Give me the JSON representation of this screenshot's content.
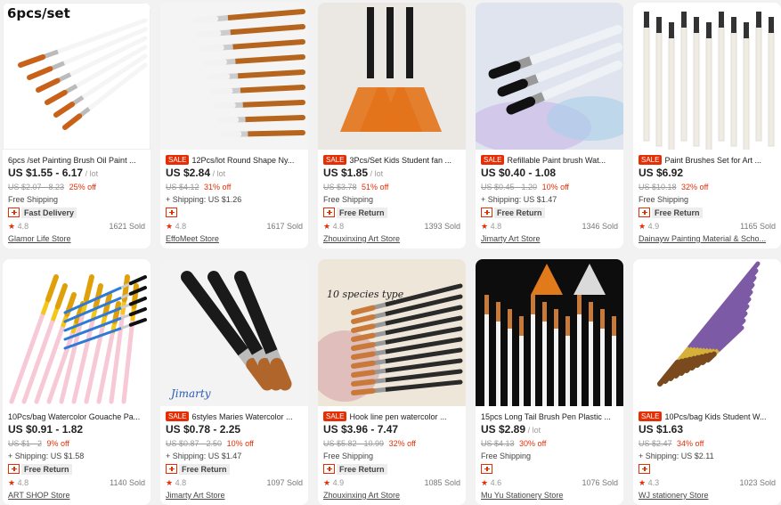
{
  "products": [
    {
      "img_label": "6pcs/set",
      "sale": false,
      "title": "6pcs /set Painting Brush Oil Paint ...",
      "price": "US $1.55 - 6.17",
      "unit": "/ lot",
      "orig": "US $2.07 - 8.23",
      "discount": "25% off",
      "shipping": "Free Shipping",
      "badge": "Fast Delivery",
      "rating": "4.8",
      "sold": "1621 Sold",
      "store": "Glamor Life Store"
    },
    {
      "img_label": "",
      "sale": true,
      "title": "12Pcs/lot Round Shape Ny...",
      "price": "US $2.84",
      "unit": "/ lot",
      "orig": "US $4.12",
      "discount": "31% off",
      "shipping": "+ Shipping: US $1.26",
      "badge": "",
      "rating": "4.8",
      "sold": "1617 Sold",
      "store": "EffoMeet Store"
    },
    {
      "img_label": "",
      "sale": true,
      "title": "3Pcs/Set Kids Student fan ...",
      "price": "US $1.85",
      "unit": "/ lot",
      "orig": "US $3.78",
      "discount": "51% off",
      "shipping": "Free Shipping",
      "badge": "Free Return",
      "rating": "4.8",
      "sold": "1393 Sold",
      "store": "Zhouxinxing Art Store"
    },
    {
      "img_label": "",
      "sale": true,
      "title": "Refillable Paint brush Wat...",
      "price": "US $0.40 - 1.08",
      "unit": "",
      "orig": "US $0.45 - 1.20",
      "discount": "10% off",
      "shipping": "+ Shipping: US $1.47",
      "badge": "Free Return",
      "rating": "4.8",
      "sold": "1346 Sold",
      "store": "Jimarty Art Store"
    },
    {
      "img_label": "",
      "sale": true,
      "title": "Paint Brushes Set for Art ...",
      "price": "US $6.92",
      "unit": "",
      "orig": "US $10.18",
      "discount": "32% off",
      "shipping": "Free Shipping",
      "badge": "Free Return",
      "rating": "4.9",
      "sold": "1165 Sold",
      "store": "Dainayw Painting Material & Scho..."
    },
    {
      "img_label": "",
      "sale": false,
      "title": "10Pcs/bag Watercolor Gouache Pa...",
      "price": "US $0.91 - 1.82",
      "unit": "",
      "orig": "US $1 - 2",
      "discount": "9% off",
      "shipping": "+ Shipping: US $1.58",
      "badge": "Free Return",
      "rating": "4.8",
      "sold": "1140 Sold",
      "store": "ART SHOP Store"
    },
    {
      "img_label": "",
      "sale": true,
      "title": "6styles Maries Watercolor ...",
      "price": "US $0.78 - 2.25",
      "unit": "",
      "orig": "US $0.87 - 2.50",
      "discount": "10% off",
      "shipping": "+ Shipping: US $1.47",
      "badge": "Free Return",
      "rating": "4.8",
      "sold": "1097 Sold",
      "store": "Jimarty Art Store"
    },
    {
      "img_label": "",
      "sale": true,
      "title": "Hook line pen watercolor ...",
      "price": "US $3.96 - 7.47",
      "unit": "",
      "orig": "US $5.82 - 10.99",
      "discount": "32% off",
      "shipping": "Free Shipping",
      "badge": "Free Return",
      "rating": "4.9",
      "sold": "1085 Sold",
      "store": "Zhouxinxing Art Store"
    },
    {
      "img_label": "",
      "sale": false,
      "title": "15pcs Long Tail Brush Pen Plastic ...",
      "price": "US $2.89",
      "unit": "/ lot",
      "orig": "US $4.13",
      "discount": "30% off",
      "shipping": "Free Shipping",
      "badge": "",
      "rating": "4.6",
      "sold": "1076 Sold",
      "store": "Mu Yu Stationery Store"
    },
    {
      "img_label": "",
      "sale": true,
      "title": "10Pcs/bag Kids Student W...",
      "price": "US $1.63",
      "unit": "",
      "orig": "US $2.47",
      "discount": "34% off",
      "shipping": "+ Shipping: US $2.11",
      "badge": "",
      "rating": "4.3",
      "sold": "1023 Sold",
      "store": "WJ stationery Store"
    }
  ],
  "sale_label": "SALE",
  "colors": {
    "sale": "#e62e04",
    "background": "#f2f2f2",
    "card": "#ffffff"
  }
}
